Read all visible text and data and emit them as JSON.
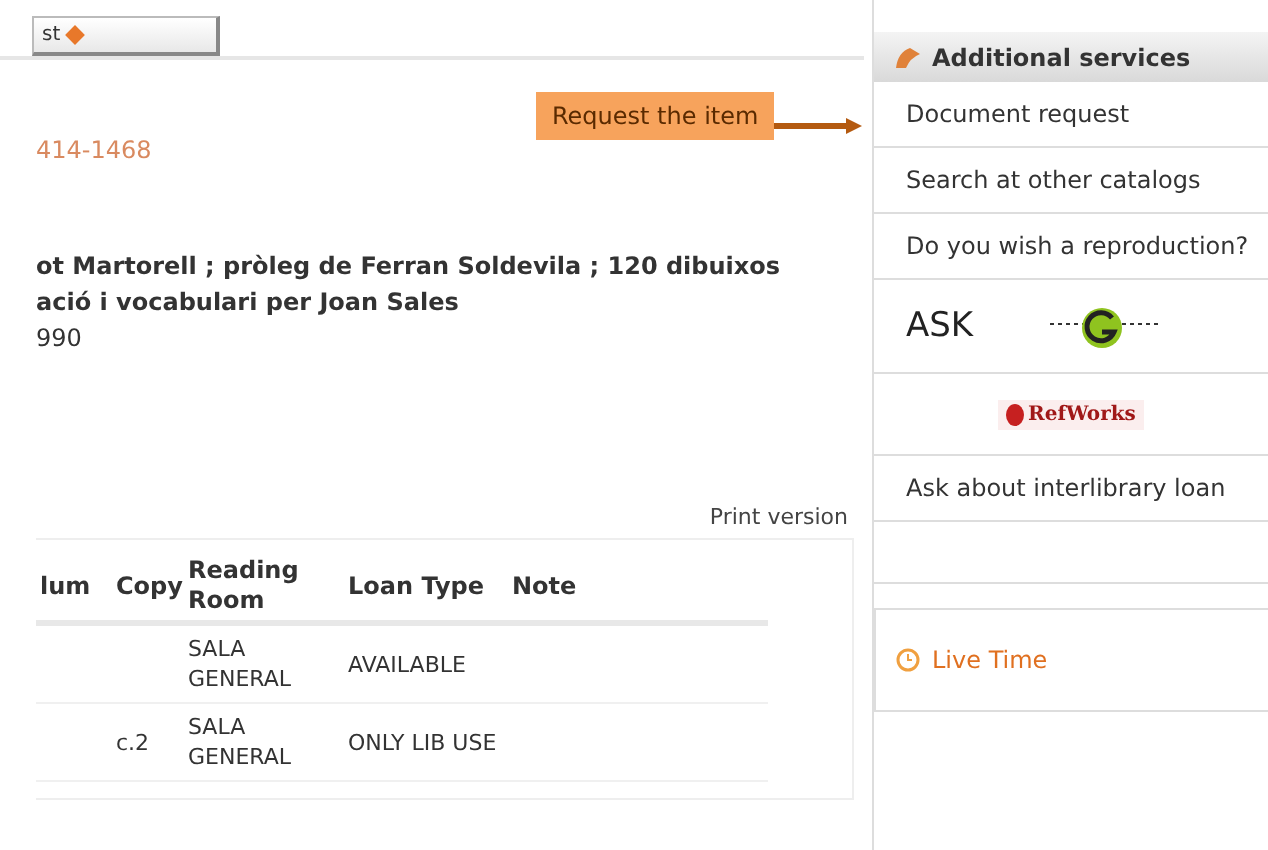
{
  "top_button": {
    "label": "st"
  },
  "record": {
    "dates": "414-1468",
    "title_lines": [
      "ot Martorell ; pròleg de Ferran Soldevila ; 120 dibuixos",
      "ació i vocabulari per Joan Sales"
    ],
    "year": "990"
  },
  "callout": {
    "label": "Request the item"
  },
  "print_link": "Print version",
  "table": {
    "columns": [
      "lum",
      "Copy",
      "Reading Room",
      "Loan Type",
      "Note"
    ],
    "rows": [
      [
        "",
        "",
        "SALA GENERAL",
        "AVAILABLE",
        ""
      ],
      [
        "",
        "c.2",
        "SALA GENERAL",
        "ONLY LIB USE",
        ""
      ]
    ]
  },
  "sidebar": {
    "title": "Additional services",
    "items": [
      {
        "kind": "link",
        "label": "Document request"
      },
      {
        "kind": "link",
        "label": "Search at other catalogs"
      },
      {
        "kind": "link",
        "label": "Do you wish a reproduction?"
      },
      {
        "kind": "ask",
        "label": "ASK"
      },
      {
        "kind": "refworks",
        "label": "RefWorks"
      },
      {
        "kind": "link",
        "label": "Ask about interlibrary loan"
      }
    ],
    "live": {
      "label": "Live Time"
    }
  }
}
